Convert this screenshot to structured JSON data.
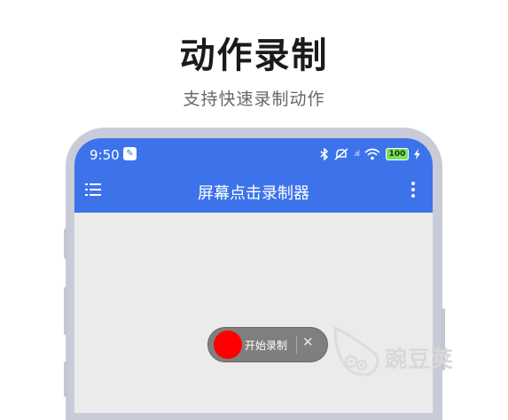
{
  "headline": "动作录制",
  "subheadline": "支持快速录制动作",
  "status_bar": {
    "time": "9:50",
    "battery": "100"
  },
  "app_bar": {
    "title": "屏幕点击录制器"
  },
  "recorder": {
    "label": "开始录制",
    "close": "✕"
  },
  "watermark": {
    "text": "豌豆荚"
  }
}
